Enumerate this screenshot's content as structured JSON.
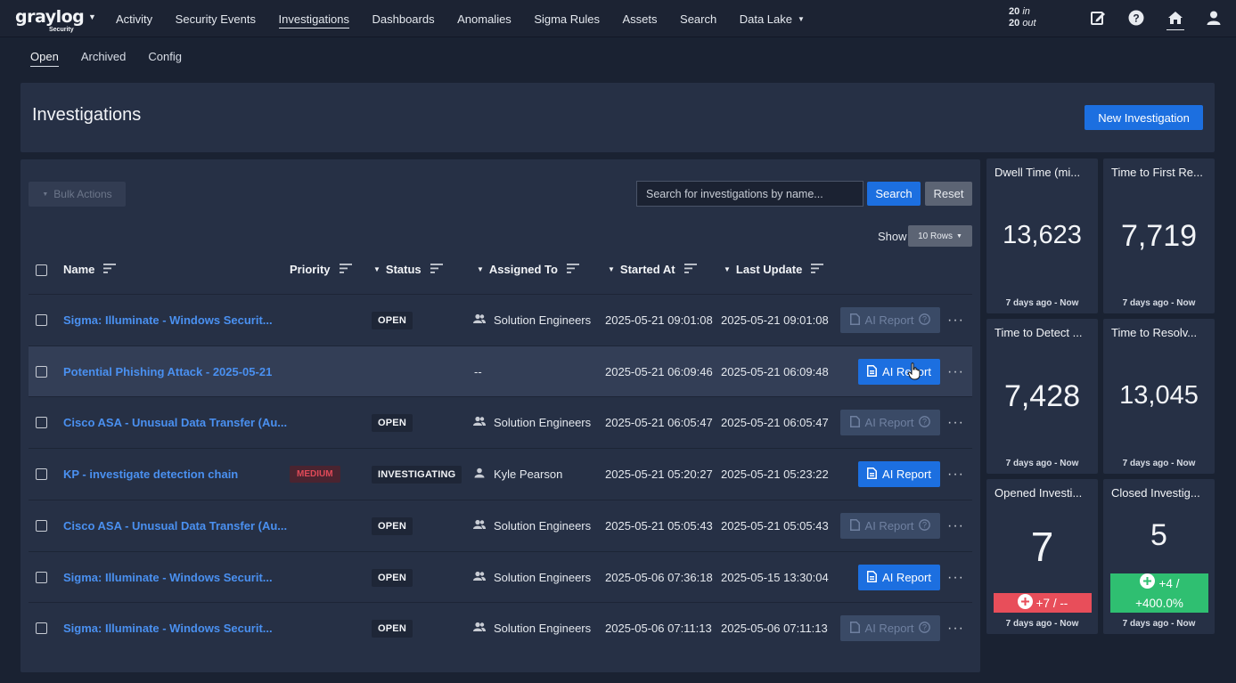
{
  "nav": {
    "logo": "graylog",
    "logo_sub": "Security",
    "items": [
      {
        "label": "Activity"
      },
      {
        "label": "Security Events"
      },
      {
        "label": "Investigations"
      },
      {
        "label": "Dashboards"
      },
      {
        "label": "Anomalies"
      },
      {
        "label": "Sigma Rules"
      },
      {
        "label": "Assets"
      },
      {
        "label": "Search"
      },
      {
        "label": "Data Lake"
      }
    ],
    "throughput_in_value": "20",
    "throughput_in_label": "in",
    "throughput_out_value": "20",
    "throughput_out_label": "out"
  },
  "subtabs": [
    {
      "label": "Open"
    },
    {
      "label": "Archived"
    },
    {
      "label": "Config"
    }
  ],
  "header": {
    "title": "Investigations",
    "new_button": "New Investigation"
  },
  "toolbar": {
    "bulk_actions": "Bulk Actions",
    "search_placeholder": "Search for investigations by name...",
    "search_button": "Search",
    "reset_button": "Reset",
    "show_label": "Show",
    "rows_option": "10 Rows"
  },
  "columns": {
    "name": "Name",
    "priority": "Priority",
    "status": "Status",
    "assigned": "Assigned To",
    "started": "Started At",
    "updated": "Last Update"
  },
  "rows": [
    {
      "name": "Sigma: Illuminate - Windows Securit...",
      "priority": "",
      "status": "OPEN",
      "assigned": "Solution Engineers",
      "started": "2025-05-21 09:01:08",
      "updated": "2025-05-21 09:01:08",
      "ai": "AI Report"
    },
    {
      "name": "Potential Phishing Attack - 2025-05-21",
      "priority": "",
      "status": "",
      "assigned": "--",
      "started": "2025-05-21 06:09:46",
      "updated": "2025-05-21 06:09:48",
      "ai": "AI Report"
    },
    {
      "name": "Cisco ASA - Unusual Data Transfer (Au...",
      "priority": "",
      "status": "OPEN",
      "assigned": "Solution Engineers",
      "started": "2025-05-21 06:05:47",
      "updated": "2025-05-21 06:05:47",
      "ai": "AI Report"
    },
    {
      "name": "KP - investigate detection chain",
      "priority": "MEDIUM",
      "status": "INVESTIGATING",
      "assigned": "Kyle Pearson",
      "started": "2025-05-21 05:20:27",
      "updated": "2025-05-21 05:23:22",
      "ai": "AI Report"
    },
    {
      "name": "Cisco ASA - Unusual Data Transfer (Au...",
      "priority": "",
      "status": "OPEN",
      "assigned": "Solution Engineers",
      "started": "2025-05-21 05:05:43",
      "updated": "2025-05-21 05:05:43",
      "ai": "AI Report"
    },
    {
      "name": "Sigma: Illuminate - Windows Securit...",
      "priority": "",
      "status": "OPEN",
      "assigned": "Solution Engineers",
      "started": "2025-05-06 07:36:18",
      "updated": "2025-05-15 13:30:04",
      "ai": "AI Report"
    },
    {
      "name": "Sigma: Illuminate - Windows Securit...",
      "priority": "",
      "status": "OPEN",
      "assigned": "Solution Engineers",
      "started": "2025-05-06 07:11:13",
      "updated": "2025-05-06 07:11:13",
      "ai": "AI Report"
    }
  ],
  "metrics": [
    {
      "title": "Dwell Time (mi...",
      "value": "13,623",
      "range": "7 days ago - Now"
    },
    {
      "title": "Time to First Re...",
      "value": "7,719",
      "range": "7 days ago - Now"
    },
    {
      "title": "Time to Detect ...",
      "value": "7,428",
      "range": "7 days ago - Now"
    },
    {
      "title": "Time to Resolv...",
      "value": "13,045",
      "range": "7 days ago - Now"
    },
    {
      "title": "Opened Investi...",
      "value": "7",
      "delta": "+7 / --",
      "range": "7 days ago - Now"
    },
    {
      "title": "Closed Investig...",
      "value": "5",
      "delta_line1": "+4 /",
      "delta_line2": "+400.0%",
      "range": "7 days ago - Now"
    }
  ],
  "colors": {
    "accent": "#1c6fe0",
    "link": "#4a90f0",
    "negative": "#e84e5a",
    "positive": "#2fbf71"
  }
}
